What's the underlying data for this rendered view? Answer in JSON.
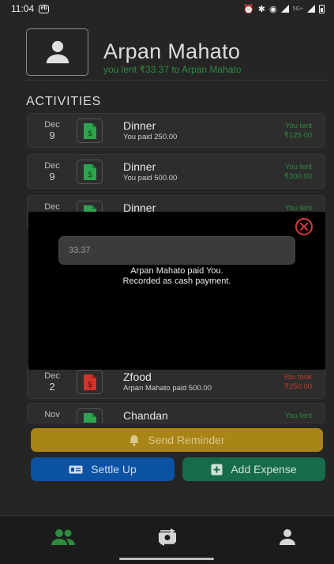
{
  "status_bar": {
    "time": "11:04",
    "app_badge": "eb",
    "network": "5G+"
  },
  "header": {
    "name": "Arpan Mahato",
    "status": "you lent ₹33.37  to Arpan Mahato"
  },
  "section_title": "ACTIVITIES",
  "activities": [
    {
      "month": "Dec",
      "day": "9",
      "title": "Dinner",
      "subtitle": "You paid 250.00",
      "amount_label": "You lent",
      "amount": "₹125.00",
      "kind": "lent"
    },
    {
      "month": "Dec",
      "day": "9",
      "title": "Dinner",
      "subtitle": "You paid 500.00",
      "amount_label": "You lent",
      "amount": "₹300.00",
      "kind": "lent"
    },
    {
      "month": "Dec",
      "day": "",
      "title": "Dinner",
      "subtitle": "",
      "amount_label": "You lent",
      "amount": "",
      "kind": "lent"
    },
    {
      "month": "Dec",
      "day": "2",
      "title": "Zfood",
      "subtitle": "Arpan Mahato paid 500.00",
      "amount_label": "You took",
      "amount": "₹250.00",
      "kind": "took"
    },
    {
      "month": "Nov",
      "day": "",
      "title": "Chandan",
      "subtitle": "",
      "amount_label": "You lent",
      "amount": "",
      "kind": "lent"
    }
  ],
  "modal": {
    "amount_value": "33.37",
    "message_line1": "Arpan Mahato paid You.",
    "message_line2": "Recorded as cash payment."
  },
  "buttons": {
    "send_reminder": "Send Reminder",
    "settle_up": "Settle Up",
    "add_expense": "Add Expense"
  },
  "colors": {
    "lent": "#2e8b3d",
    "took": "#c0392b",
    "reminder": "#a98416",
    "settle": "#0b52a3",
    "expense": "#166c4a",
    "nav_active": "#2e8b3d"
  },
  "nav": [
    "friends-icon",
    "money-transfer-icon",
    "profile-icon"
  ]
}
